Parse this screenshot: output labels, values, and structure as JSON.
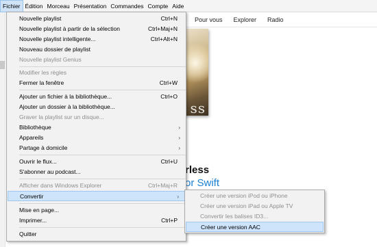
{
  "menubar": {
    "items": [
      "Fichier",
      "Édition",
      "Morceau",
      "Présentation",
      "Commandes",
      "Compte",
      "Aide"
    ]
  },
  "nav": {
    "tabs": [
      "Pour vous",
      "Explorer",
      "Radio"
    ]
  },
  "album": {
    "art_text": "ss",
    "title": "rless",
    "artist": "or Swift"
  },
  "file_menu": {
    "items": [
      {
        "label": "Nouvelle playlist",
        "shortcut": "Ctrl+N",
        "enabled": true
      },
      {
        "label": "Nouvelle playlist à partir de la sélection",
        "shortcut": "Ctrl+Maj+N",
        "enabled": true
      },
      {
        "label": "Nouvelle playlist intelligente...",
        "shortcut": "Ctrl+Alt+N",
        "enabled": true
      },
      {
        "label": "Nouveau dossier de playlist",
        "shortcut": "",
        "enabled": true
      },
      {
        "label": "Nouvelle playlist Genius",
        "shortcut": "",
        "enabled": false
      },
      {
        "label": "Modifier les règles",
        "shortcut": "",
        "enabled": false
      },
      {
        "label": "Fermer la fenêtre",
        "shortcut": "Ctrl+W",
        "enabled": true
      },
      {
        "label": "Ajouter un fichier à la bibliothèque...",
        "shortcut": "Ctrl+O",
        "enabled": true
      },
      {
        "label": "Ajouter un dossier à la bibliothèque...",
        "shortcut": "",
        "enabled": true
      },
      {
        "label": "Graver la playlist sur un disque...",
        "shortcut": "",
        "enabled": false
      },
      {
        "label": "Bibliothèque",
        "shortcut": "",
        "enabled": true,
        "submenu": true
      },
      {
        "label": "Appareils",
        "shortcut": "",
        "enabled": true,
        "submenu": true
      },
      {
        "label": "Partage à domicile",
        "shortcut": "",
        "enabled": true,
        "submenu": true
      },
      {
        "label": "Ouvrir le flux...",
        "shortcut": "Ctrl+U",
        "enabled": true
      },
      {
        "label": "S'abonner au podcast...",
        "shortcut": "",
        "enabled": true
      },
      {
        "label": "Afficher dans Windows Explorer",
        "shortcut": "Ctrl+Maj+R",
        "enabled": false
      },
      {
        "label": "Convertir",
        "shortcut": "",
        "enabled": true,
        "submenu": true,
        "highlighted": true
      },
      {
        "label": "Mise en page...",
        "shortcut": "",
        "enabled": true
      },
      {
        "label": "Imprimer...",
        "shortcut": "Ctrl+P",
        "enabled": true
      },
      {
        "label": "Quitter",
        "shortcut": "",
        "enabled": true
      }
    ]
  },
  "convert_submenu": {
    "items": [
      {
        "label": "Créer une version iPod ou iPhone",
        "enabled": false
      },
      {
        "label": "Créer une version iPad ou Apple TV",
        "enabled": false
      },
      {
        "label": "Convertir les balises ID3...",
        "enabled": false
      },
      {
        "label": "Créer une version AAC",
        "enabled": true,
        "highlighted": true
      }
    ]
  },
  "icons": {
    "submenu_arrow": "chevron-right-icon"
  },
  "colors": {
    "highlight": "#cde4fb",
    "artist_link": "#1b7fcf",
    "disabled_text": "#8e8e8e"
  }
}
